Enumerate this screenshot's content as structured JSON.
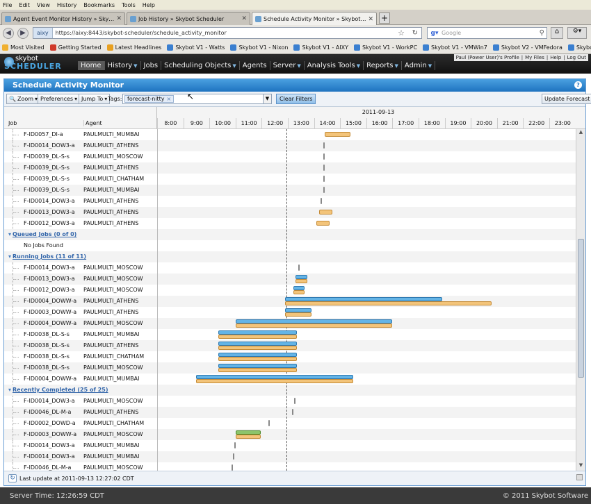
{
  "browser": {
    "menu": [
      "File",
      "Edit",
      "View",
      "History",
      "Bookmarks",
      "Tools",
      "Help"
    ],
    "tabs": [
      {
        "label": "Agent Event Monitor History » Skybot Sc..."
      },
      {
        "label": "Job History » Skybot Scheduler"
      },
      {
        "label": "Schedule Activity Monitor » Skybot Sched..."
      }
    ],
    "new_tab": "+",
    "site_label": "aixy",
    "url": "https://aixy:8443/skybot-scheduler/schedule_activity_monitor",
    "search_placeholder": "Google",
    "bookmarks": [
      "Most Visited",
      "Getting Started",
      "Latest Headlines",
      "Skybot V1 - Watts",
      "Skybot V1 - Nixon",
      "Skybot V1 - AIXY",
      "Skybot V1 - WorkPC",
      "Skybot V1 - VMWin7",
      "Skybot V2 - VMFedora",
      "Skybot-Washington"
    ]
  },
  "app": {
    "logo_top": "skybot",
    "logo_bottom": "SCHEDULER",
    "user_links": [
      "Paul (Power User)'s Profile",
      "My Files",
      "Help",
      "Log Out"
    ],
    "nav": [
      {
        "label": "Home",
        "dropdown": false
      },
      {
        "label": "History",
        "dropdown": true
      },
      {
        "label": "Jobs",
        "dropdown": false
      },
      {
        "label": "Scheduling Objects",
        "dropdown": true
      },
      {
        "label": "Agents",
        "dropdown": false
      },
      {
        "label": "Server",
        "dropdown": true
      },
      {
        "label": "Analysis Tools",
        "dropdown": true
      },
      {
        "label": "Reports",
        "dropdown": true
      },
      {
        "label": "Admin",
        "dropdown": true
      }
    ]
  },
  "panel": {
    "title": "Schedule Activity Monitor",
    "toolbar": {
      "zoom": "Zoom",
      "preferences": "Preferences",
      "jump_to": "Jump To",
      "tags_label": "Tags:",
      "tag": "forecast-nitty",
      "clear_filters": "Clear Filters",
      "update_forecast": "Update Forecast"
    },
    "columns": {
      "job": "Job",
      "agent": "Agent"
    },
    "date": "2011-09-13",
    "hours": [
      "8:00",
      "9:00",
      "10:00",
      "11:00",
      "12:00",
      "13:00",
      "14:00",
      "15:00",
      "16:00",
      "17:00",
      "18:00",
      "19:00",
      "20:00",
      "21:00",
      "22:00",
      "23:00"
    ],
    "now_time": 12.45,
    "footer": "Last update at 2011-09-13 12:27:02 CDT"
  },
  "rows": [
    {
      "kind": "job",
      "job": "F-ID0057_DI-a",
      "agent": "PAULMULTI_MUMBAI",
      "bars": [
        {
          "c": "orange",
          "s": 13.9,
          "e": 14.9
        }
      ]
    },
    {
      "kind": "job",
      "job": "F-ID0014_DOW3-a",
      "agent": "PAULMULTI_ATHENS",
      "bars": [
        {
          "c": "tick",
          "s": 13.85,
          "e": 13.9
        }
      ]
    },
    {
      "kind": "job",
      "job": "F-ID0039_DL-S-s",
      "agent": "PAULMULTI_MOSCOW",
      "bars": [
        {
          "c": "tick",
          "s": 13.85,
          "e": 13.9
        }
      ]
    },
    {
      "kind": "job",
      "job": "F-ID0039_DL-S-s",
      "agent": "PAULMULTI_ATHENS",
      "bars": [
        {
          "c": "tick",
          "s": 13.85,
          "e": 13.9
        }
      ]
    },
    {
      "kind": "job",
      "job": "F-ID0039_DL-S-s",
      "agent": "PAULMULTI_CHATHAM",
      "bars": [
        {
          "c": "tick",
          "s": 13.85,
          "e": 13.9
        }
      ]
    },
    {
      "kind": "job",
      "job": "F-ID0039_DL-S-s",
      "agent": "PAULMULTI_MUMBAI",
      "bars": [
        {
          "c": "tick",
          "s": 13.85,
          "e": 13.9
        }
      ]
    },
    {
      "kind": "job",
      "job": "F-ID0014_DOW3-a",
      "agent": "PAULMULTI_ATHENS",
      "bars": [
        {
          "c": "tick",
          "s": 13.75,
          "e": 13.8
        }
      ]
    },
    {
      "kind": "job",
      "job": "F-ID0013_DOW3-a",
      "agent": "PAULMULTI_ATHENS",
      "bars": [
        {
          "c": "orange",
          "s": 13.7,
          "e": 14.2
        }
      ]
    },
    {
      "kind": "job",
      "job": "F-ID0012_DOW3-a",
      "agent": "PAULMULTI_ATHENS",
      "bars": [
        {
          "c": "orange",
          "s": 13.6,
          "e": 14.1
        }
      ]
    },
    {
      "kind": "group",
      "title": "Queued Jobs (0 of 0)"
    },
    {
      "kind": "empty",
      "text": "No Jobs Found"
    },
    {
      "kind": "group",
      "title": "Running Jobs (11 of 11)"
    },
    {
      "kind": "job",
      "job": "F-ID0014_DOW3-a",
      "agent": "PAULMULTI_MOSCOW",
      "bars": [
        {
          "c": "tick",
          "s": 12.9,
          "e": 12.95
        }
      ]
    },
    {
      "kind": "job",
      "job": "F-ID0013_DOW3-a",
      "agent": "PAULMULTI_MOSCOW",
      "bars": [
        {
          "c": "blue",
          "s": 12.8,
          "e": 13.25
        },
        {
          "c": "orange",
          "s": 12.8,
          "e": 13.25
        }
      ]
    },
    {
      "kind": "job",
      "job": "F-ID0012_DOW3-a",
      "agent": "PAULMULTI_MOSCOW",
      "bars": [
        {
          "c": "blue",
          "s": 12.7,
          "e": 13.15
        },
        {
          "c": "orange",
          "s": 12.7,
          "e": 13.15
        }
      ]
    },
    {
      "kind": "job",
      "job": "F-ID0004_DOWW-a",
      "agent": "PAULMULTI_ATHENS",
      "bars": [
        {
          "c": "blue",
          "s": 12.4,
          "e": 18.4
        },
        {
          "c": "orange",
          "s": 12.4,
          "e": 20.3
        }
      ]
    },
    {
      "kind": "job",
      "job": "F-ID0003_DOWW-a",
      "agent": "PAULMULTI_ATHENS",
      "bars": [
        {
          "c": "blue",
          "s": 12.4,
          "e": 13.4
        },
        {
          "c": "orange",
          "s": 12.4,
          "e": 13.4
        }
      ]
    },
    {
      "kind": "job",
      "job": "F-ID0004_DOWW-a",
      "agent": "PAULMULTI_MOSCOW",
      "bars": [
        {
          "c": "blue",
          "s": 10.5,
          "e": 16.5
        },
        {
          "c": "orange",
          "s": 10.5,
          "e": 16.5
        }
      ]
    },
    {
      "kind": "job",
      "job": "F-ID0038_DL-S-s",
      "agent": "PAULMULTI_MUMBAI",
      "bars": [
        {
          "c": "blue",
          "s": 9.85,
          "e": 12.85
        },
        {
          "c": "orange",
          "s": 9.85,
          "e": 12.85
        }
      ]
    },
    {
      "kind": "job",
      "job": "F-ID0038_DL-S-s",
      "agent": "PAULMULTI_ATHENS",
      "bars": [
        {
          "c": "blue",
          "s": 9.85,
          "e": 12.85
        },
        {
          "c": "orange",
          "s": 9.85,
          "e": 12.85
        }
      ]
    },
    {
      "kind": "job",
      "job": "F-ID0038_DL-S-s",
      "agent": "PAULMULTI_CHATHAM",
      "bars": [
        {
          "c": "blue",
          "s": 9.85,
          "e": 12.85
        },
        {
          "c": "orange",
          "s": 9.85,
          "e": 12.85
        }
      ]
    },
    {
      "kind": "job",
      "job": "F-ID0038_DL-S-s",
      "agent": "PAULMULTI_MOSCOW",
      "bars": [
        {
          "c": "blue",
          "s": 9.85,
          "e": 12.85
        },
        {
          "c": "orange",
          "s": 9.85,
          "e": 12.85
        }
      ]
    },
    {
      "kind": "job",
      "job": "F-ID0004_DOWW-a",
      "agent": "PAULMULTI_MUMBAI",
      "bars": [
        {
          "c": "blue",
          "s": 9.0,
          "e": 15.0
        },
        {
          "c": "orange",
          "s": 9.0,
          "e": 15.0
        }
      ]
    },
    {
      "kind": "group",
      "title": "Recently Completed (25 of 25)"
    },
    {
      "kind": "job",
      "job": "F-ID0014_DOW3-a",
      "agent": "PAULMULTI_MOSCOW",
      "bars": [
        {
          "c": "tick",
          "s": 12.75,
          "e": 12.8
        }
      ]
    },
    {
      "kind": "job",
      "job": "F-ID0046_DL-M-a",
      "agent": "PAULMULTI_ATHENS",
      "bars": [
        {
          "c": "tick",
          "s": 12.65,
          "e": 12.7
        }
      ]
    },
    {
      "kind": "job",
      "job": "F-ID0002_DOWD-a",
      "agent": "PAULMULTI_CHATHAM",
      "bars": [
        {
          "c": "tick",
          "s": 11.75,
          "e": 11.8
        }
      ]
    },
    {
      "kind": "job",
      "job": "F-ID0003_DOWW-a",
      "agent": "PAULMULTI_MOSCOW",
      "bars": [
        {
          "c": "green",
          "s": 10.5,
          "e": 11.45
        },
        {
          "c": "orange",
          "s": 10.5,
          "e": 11.45
        }
      ]
    },
    {
      "kind": "job",
      "job": "F-ID0014_DOW3-a",
      "agent": "PAULMULTI_MUMBAI",
      "bars": [
        {
          "c": "tick",
          "s": 10.45,
          "e": 10.5
        }
      ]
    },
    {
      "kind": "job",
      "job": "F-ID0014_DOW3-a",
      "agent": "PAULMULTI_MUMBAI",
      "bars": [
        {
          "c": "tick",
          "s": 10.4,
          "e": 10.45
        }
      ]
    },
    {
      "kind": "job",
      "job": "F-ID0046_DL-M-a",
      "agent": "PAULMULTI_MOSCOW",
      "bars": [
        {
          "c": "tick",
          "s": 10.35,
          "e": 10.4
        }
      ]
    }
  ],
  "statusbar": {
    "server_time": "Server Time: 12:26:59 CDT",
    "copyright": "© 2011 Skybot Software"
  },
  "colors": {
    "running_actual": "#64b4e6",
    "forecast": "#f3c47a",
    "completed": "#8cc46a",
    "title_bar": "#1e73c0"
  }
}
